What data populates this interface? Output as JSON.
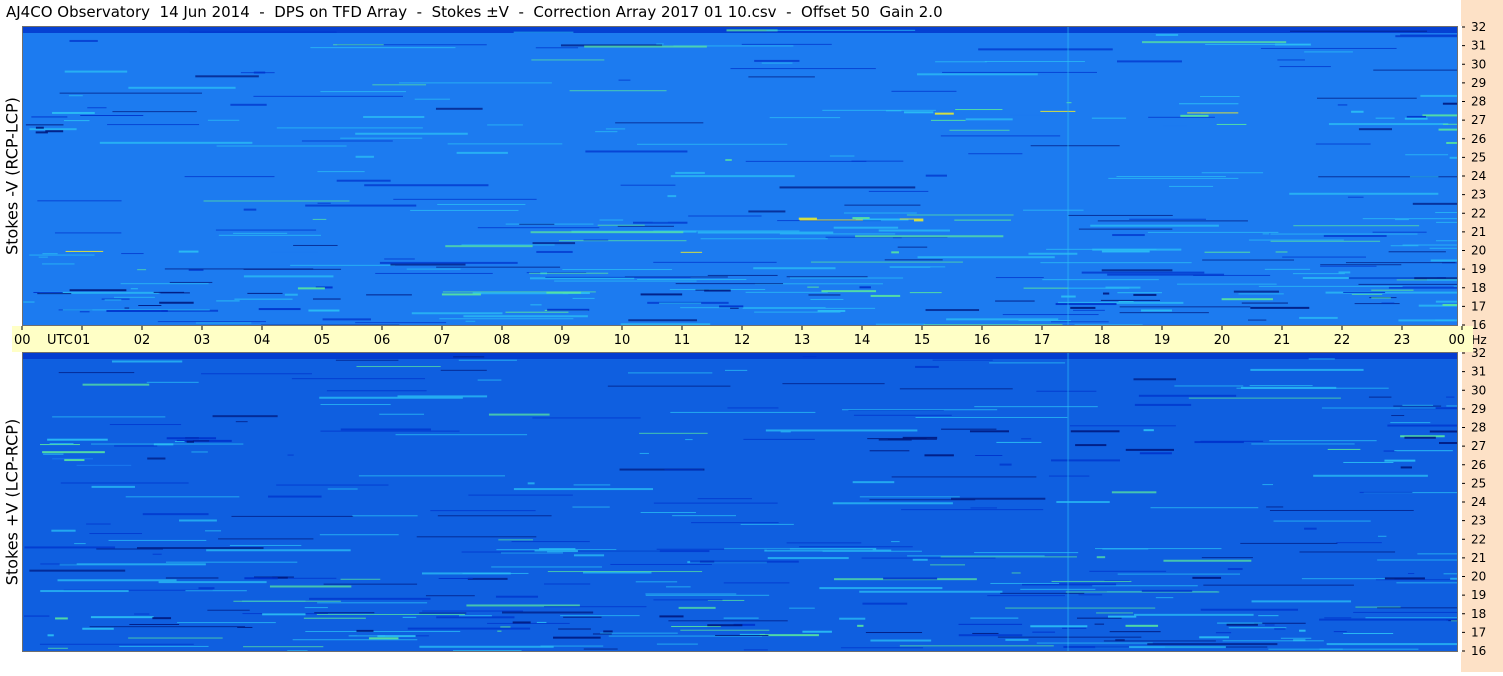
{
  "title": "AJ4CO Observatory  14 Jun 2014  -  DPS on TFD Array  -  Stokes ±V  -  Correction Array 2017 01 10.csv  -  Offset 50  Gain 2.0",
  "panels": {
    "top_ylabel": "Stokes -V (RCP-LCP)",
    "bottom_ylabel": "Stokes +V (LCP-RCP)"
  },
  "colors": {
    "top_background": "#1c7bf0",
    "bottom_background": "#0f5fe0",
    "time_axis_band": "#ffffc6",
    "freq_axis_band": "#fde1c6"
  },
  "chart_data": [
    {
      "type": "heatmap",
      "panel": "top",
      "ylabel": "Stokes -V (RCP-LCP)",
      "x_axis": {
        "label": "UTC",
        "ticks": [
          "00",
          "01",
          "02",
          "03",
          "04",
          "05",
          "06",
          "07",
          "08",
          "09",
          "10",
          "11",
          "12",
          "13",
          "14",
          "15",
          "16",
          "17",
          "18",
          "19",
          "20",
          "21",
          "22",
          "23",
          "00"
        ],
        "range_hours": [
          0,
          24
        ]
      },
      "y_axis": {
        "unit": "MHz",
        "ticks": [
          32,
          31,
          30,
          29,
          28,
          27,
          26,
          25,
          24,
          23,
          22,
          21,
          20,
          19,
          18,
          17,
          16
        ],
        "range": [
          16,
          32
        ]
      },
      "colormap": [
        "#001a80",
        "#0033cc",
        "#1c7bf0",
        "#2bc0f5",
        "#58e6a0",
        "#e8e830",
        "#ff8030"
      ],
      "features": [
        {
          "freq_mhz": [
            26,
            27.5
          ],
          "hours": [
            0,
            1.0
          ],
          "level": "low"
        },
        {
          "freq_mhz": [
            26.5,
            28
          ],
          "hours": [
            14,
            20
          ],
          "level": "high"
        },
        {
          "freq_mhz": [
            25.8,
            28
          ],
          "hours": [
            21.5,
            24
          ],
          "level": "mixed"
        },
        {
          "freq_mhz": [
            21.7,
            21.9
          ],
          "hours": [
            12,
            16
          ],
          "level": "high"
        },
        {
          "freq_mhz": [
            20.0,
            20.1
          ],
          "hours": [
            0,
            24
          ],
          "level": "high"
        },
        {
          "freq_mhz": [
            16.8,
            18.2
          ],
          "hours": [
            0,
            24
          ],
          "level": "mixed"
        }
      ]
    },
    {
      "type": "heatmap",
      "panel": "bottom",
      "ylabel": "Stokes +V (LCP-RCP)",
      "x_axis": {
        "label": "UTC",
        "ticks": [
          "00",
          "01",
          "02",
          "03",
          "04",
          "05",
          "06",
          "07",
          "08",
          "09",
          "10",
          "11",
          "12",
          "13",
          "14",
          "15",
          "16",
          "17",
          "18",
          "19",
          "20",
          "21",
          "22",
          "23",
          "00"
        ],
        "range_hours": [
          0,
          24
        ]
      },
      "y_axis": {
        "unit": "MHz",
        "ticks": [
          32,
          31,
          30,
          29,
          28,
          27,
          26,
          25,
          24,
          23,
          22,
          21,
          20,
          19,
          18,
          17,
          16
        ],
        "range": [
          16,
          32
        ]
      },
      "colormap": [
        "#001a80",
        "#0033cc",
        "#1c7bf0",
        "#2bc0f5",
        "#58e6a0",
        "#e8e830",
        "#ff8030"
      ],
      "features": [
        {
          "freq_mhz": [
            26,
            27.5
          ],
          "hours": [
            0,
            1.0
          ],
          "level": "high"
        },
        {
          "freq_mhz": [
            26.8,
            27.6
          ],
          "hours": [
            1.5,
            3.0
          ],
          "level": "low"
        },
        {
          "freq_mhz": [
            26.5,
            28
          ],
          "hours": [
            14,
            20
          ],
          "level": "low"
        },
        {
          "freq_mhz": [
            25.8,
            28
          ],
          "hours": [
            21.5,
            24
          ],
          "level": "mixed"
        },
        {
          "freq_mhz": [
            20.0,
            20.1
          ],
          "hours": [
            0,
            24
          ],
          "level": "low"
        },
        {
          "freq_mhz": [
            16.8,
            18.2
          ],
          "hours": [
            0,
            24
          ],
          "level": "mixed"
        }
      ]
    }
  ],
  "axis_text": {
    "utc_label": "UTC",
    "mhz_label": "MHz"
  }
}
